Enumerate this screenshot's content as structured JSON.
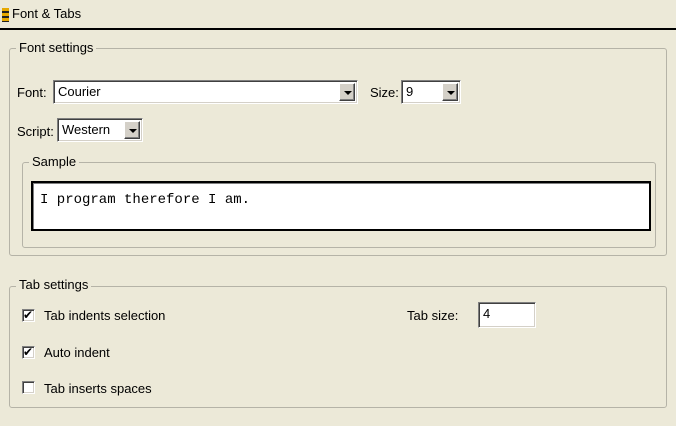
{
  "panel": {
    "title": "Font & Tabs"
  },
  "font_settings": {
    "legend": "Font settings",
    "font_label": "Font:",
    "font_value": "Courier",
    "size_label": "Size:",
    "size_value": "9",
    "script_label": "Script:",
    "script_value": "Western",
    "sample": {
      "legend": "Sample",
      "text": "I program therefore I am."
    }
  },
  "tab_settings": {
    "legend": "Tab settings",
    "tab_size_label": "Tab size:",
    "tab_size_value": "4",
    "options": [
      {
        "label": "Tab indents selection",
        "checked": true
      },
      {
        "label": "Auto indent",
        "checked": true
      },
      {
        "label": "Tab inserts spaces",
        "checked": false
      }
    ]
  },
  "icons": {
    "panel_icon": "hazard-stripe-icon",
    "dropdown": "chevron-down-icon",
    "checkmark": "✔"
  }
}
